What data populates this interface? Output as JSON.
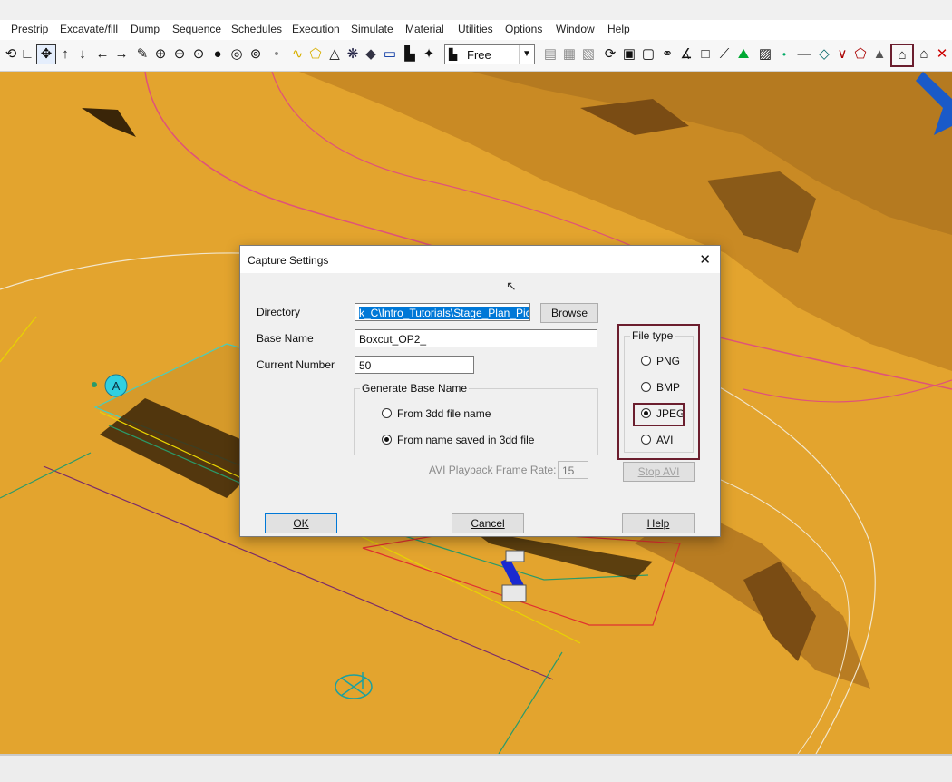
{
  "menu": [
    "Prestrip",
    "Excavate/fill",
    "Dump",
    "Sequence",
    "Schedules",
    "Execution",
    "Simulate",
    "Material",
    "Utilities",
    "Options",
    "Window",
    "Help"
  ],
  "toolbar": {
    "view_mode": "Free",
    "icons": [
      "rotate-icon",
      "axes-icon",
      "pan-icon",
      "arrow-up-icon",
      "arrow-down-icon",
      "arrow-left-icon",
      "arrow-right-icon",
      "pencil-icon",
      "zoom-in-icon",
      "zoom-out-icon",
      "zoom-window-icon",
      "sphere-icon",
      "target-icon",
      "zoom-extents-icon",
      "dot-icon",
      "polyline-icon",
      "polygon-icon",
      "triangle-icon",
      "snowflake-icon",
      "diamond-icon",
      "rectangle-icon",
      "graph-icon",
      "compass-icon"
    ],
    "icons_right": [
      "save-icon",
      "print-icon",
      "layers-icon",
      "refresh-icon",
      "box-icon",
      "frame-icon",
      "link-icon",
      "angle-icon",
      "square-icon",
      "brush-icon",
      "chart-icon",
      "capture-icon",
      "point-icon",
      "line-icon",
      "diamond-shape-icon",
      "check-icon",
      "pentagon-icon",
      "mountain-icon",
      "capture-image-icon",
      "house-icon",
      "close-icon"
    ]
  },
  "dialog": {
    "title": "Capture Settings",
    "directory_label": "Directory",
    "directory_value": "k_C\\Intro_Tutorials\\Stage_Plan_Pics\\",
    "browse": "Browse",
    "base_name_label": "Base Name",
    "base_name_value": "Boxcut_OP2_",
    "current_number_label": "Current Number",
    "current_number_value": "50",
    "generate_group": "Generate Base Name",
    "gen_options": [
      "From 3dd file name",
      "From name saved in 3dd file"
    ],
    "gen_selected": 1,
    "filetype_group": "File type",
    "filetypes": [
      "PNG",
      "BMP",
      "JPEG",
      "AVI"
    ],
    "filetype_selected": 2,
    "frame_rate_label": "AVI Playback Frame Rate:",
    "frame_rate_value": "15",
    "stop_avi": "Stop AVI",
    "ok": "OK",
    "cancel": "Cancel",
    "help": "Help"
  },
  "scene": {
    "marker_label": "A",
    "colors": {
      "terrain": "#E3A42E",
      "pit_outline": "#E0527A",
      "highlight": "#6b1e2e"
    }
  }
}
